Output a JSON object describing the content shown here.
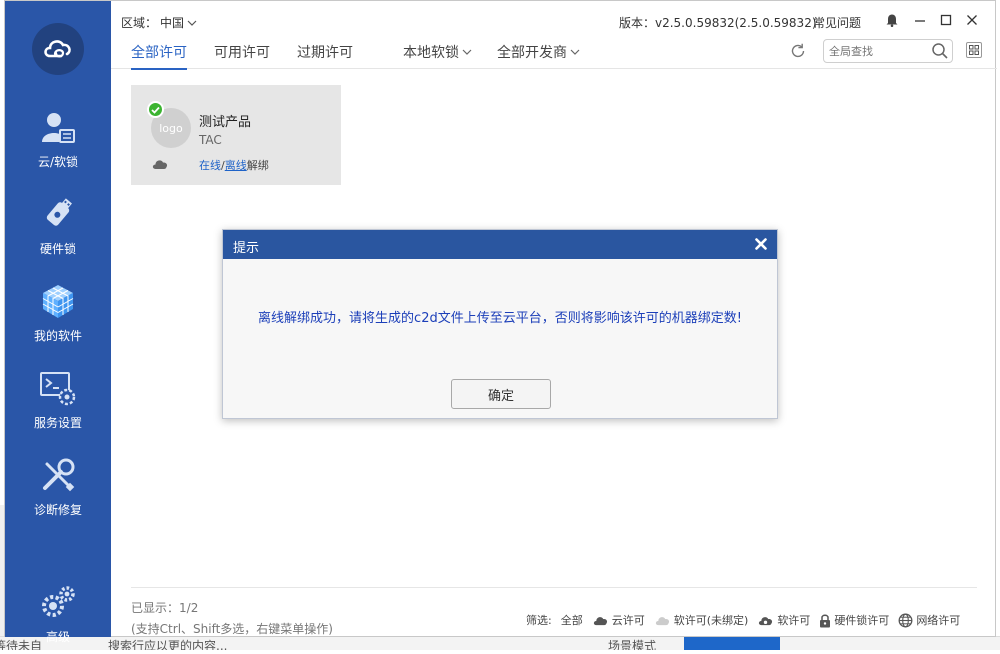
{
  "backdrop": {
    "bottom_texts": [
      "等待未自",
      "搜索行应以更的内容...",
      "场景模式"
    ]
  },
  "sidebar": {
    "logo_icon": "cloud-logo-icon",
    "items": [
      {
        "label": "云/软锁",
        "icon": "user-card-icon"
      },
      {
        "label": "硬件锁",
        "icon": "usb-key-icon"
      },
      {
        "label": "我的软件",
        "icon": "cube-icon"
      },
      {
        "label": "服务设置",
        "icon": "terminal-gear-icon"
      },
      {
        "label": "诊断修复",
        "icon": "tools-icon"
      },
      {
        "label": "高级",
        "icon": "gears-icon"
      }
    ]
  },
  "header": {
    "region_label": "区域：",
    "region_value": "中国",
    "version": "版本：v2.5.0.59832(2.5.0.59832)",
    "faq": "常见问题",
    "tabs": [
      {
        "label": "全部许可",
        "active": true
      },
      {
        "label": "可用许可",
        "active": false
      },
      {
        "label": "过期许可",
        "active": false
      }
    ],
    "dropdown_local": "本地软锁",
    "dropdown_dev": "全部开发商",
    "search_placeholder": "全局查找"
  },
  "product_card": {
    "logo_text": "logo",
    "name": "测试产品",
    "vendor": "TAC",
    "link_online": "在线",
    "slash": "/",
    "link_offline": "离线",
    "unbind": "解绑"
  },
  "dialog": {
    "title": "提示",
    "message": "离线解绑成功，请将生成的c2d文件上传至云平台，否则将影响该许可的机器绑定数!",
    "ok_label": "确定"
  },
  "footer": {
    "shown_label": "已显示：",
    "shown_value": "1/2",
    "hint": "(支持Ctrl、Shift多选，右键菜单操作)",
    "filter_label": "筛选:",
    "filters": {
      "all": "全部",
      "cloud": "云许可",
      "soft_unbound": "软许可(未绑定)",
      "soft": "软许可",
      "hardware": "硬件锁许可",
      "network": "网络许可"
    }
  },
  "colors": {
    "sidebar": "#2a56a8",
    "accent": "#2a63c3",
    "dialog_header": "#2a56a0",
    "dialog_message": "#1c3fb9",
    "check": "#3cb431"
  }
}
